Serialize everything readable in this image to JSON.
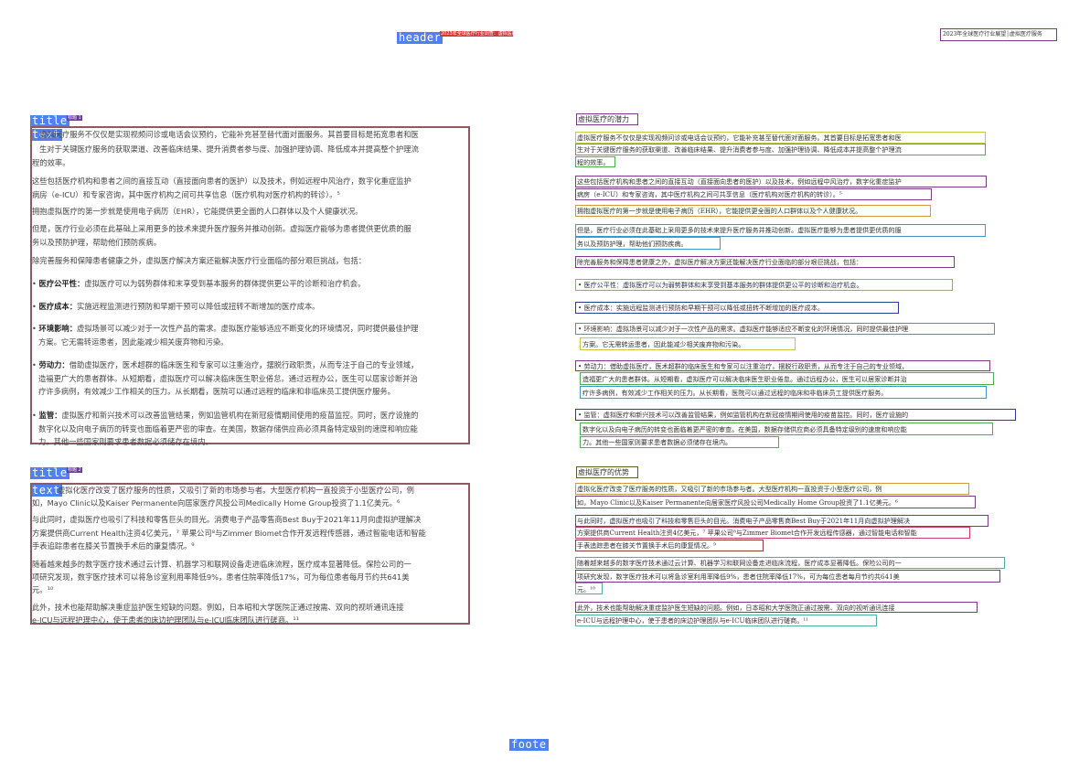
{
  "header": {
    "tag": "header",
    "red_badge": "2023年全球医疗行业调查：虚拟医疗服务",
    "right_text": "2023年全球医疗行业展望│虚拟医疗服务"
  },
  "footer": {
    "tag": "foote"
  },
  "labels": {
    "title": "title",
    "text": "text",
    "section1_mini": "标题 1",
    "section2_mini": "标题 2"
  },
  "section1": {
    "title": "虚拟医疗的潜力",
    "paragraphs": [
      "虚拟医疗服务不仅仅是实现视频问诊或电话会议预约，它能补充甚至替代面对面服务。其首要目标是拓宽患者和医",
      "生对于关键医疗服务的获取渠道、改善临床结果、提升消费者参与度、加强护理协调、降低成本并提高整个护理流",
      "程的效率。",
      "这些包括医疗机构和患者之间的直接互动（直接面向患者的医护）以及技术，例如远程中风治疗，数字化重症监护",
      "病房（e-ICU）和专家咨询，其中医疗机构之间可共享信息（医疗机构对医疗机构的转诊）。⁵",
      "拥抱虚拟医疗的第一步就是使用电子病历（EHR），它能提供更全面的人口群体以及个人健康状况。",
      "但是，医疗行业必须在此基础上采用更多的技术来提升医疗服务并推动创新。虚拟医疗能够为患者提供更优质的服",
      "务以及预防护理，帮助他们预防疾病。",
      "除完善服务和保障患者健康之外，虚拟医疗解决方案还能解决医疗行业面临的部分艰巨挑战，包括："
    ],
    "bullets": [
      {
        "label": "医疗公平性：",
        "lines": [
          "虚拟医疗可以为弱势群体和末享受到基本服务的群体提供更公平的诊断和治疗机会。"
        ]
      },
      {
        "label": "医疗成本：",
        "lines": [
          "实施远程监测进行预防和早期干预可以降低或扭转不断增加的医疗成本。"
        ]
      },
      {
        "label": "环境影响：",
        "lines": [
          "虚拟场景可以减少对于一次性产品的需求。虚拟医疗能够适应不断变化的环境情况，同时提供最佳护理",
          "方案。它无需转运患者，因此能减少相关废弃物和污染。"
        ]
      },
      {
        "label": "劳动力：",
        "lines": [
          "借助虚拟医疗，医术超群的临床医生和专家可以注重治疗，摆脱行政职责，从而专注于自己的专业领域，",
          "造福更广大的患者群体。从短期看，虚拟医疗可以解决临床医生职业倦怠。通过远程办公，医生可以居家诊断并治",
          "疗许多病例，有效减少工作相关的压力。从长期看，医院可以通过远程的临床和非临床员工提供医疗服务。"
        ]
      },
      {
        "label": "监管：",
        "lines": [
          "虚拟医疗和新兴技术可以改善监管结果，例如监管机构在新冠疫情期间使用的疫苗监控。同时，医疗设施的",
          "数字化以及向电子病历的转变也面临着更严密的审查。在美国，数据存储供应商必须具备特定级别的速度和响应能",
          "力。其他一些国家则要求患者数据必须储存在境内。"
        ]
      }
    ]
  },
  "section2": {
    "title": "虚拟医疗的优势",
    "paragraphs": [
      "虚拟化医疗改变了医疗服务的性质，又吸引了新的市场参与者。大型医疗机构一直投资于小型医疗公司，例",
      "如，Mayo Clinic以及Kaiser Permanente向居家医疗风投公司Medically Home Group投资了1.1亿美元。⁶",
      "与此同时，虚拟医疗也吸引了科技和零售巨头的目光。消费电子产品零售商Best Buy于2021年11月向虚拟护理解决",
      "方案提供商Current Health注资4亿美元，⁷ 苹果公司⁸与Zimmer Biomet合作开发远程传感器，通过智能电话和智能",
      "手表追踪患者在膝关节置换手术后的康复情况。⁹",
      "随着越来越多的数字医疗技术通过云计算、机器学习和联网设备走进临床流程，医疗成本显著降低。保险公司的一",
      "项研究发现，数字医疗技术可以将急诊室利用率降低9%，患者住院率降低17%，可为每位患者每月节约共641美",
      "元。¹⁰",
      "此外，技术也能帮助解决重症监护医生短缺的问题。例如，日本昭和大学医院正通过按需、双向的视听通讯连接",
      "e-ICU与远程护理中心，使于患者的床边护理团队与e-ICU临床团队进行磋商。¹¹"
    ]
  },
  "colors": {
    "box_left": "#8c5a63",
    "tag_blue": "#4f81f2",
    "box_purple": "#7a3a8a",
    "box_yellow": "#c8c83a",
    "box_blue": "#3a9ad0",
    "box_green": "#4ab04a",
    "box_orange": "#d09a3a"
  }
}
